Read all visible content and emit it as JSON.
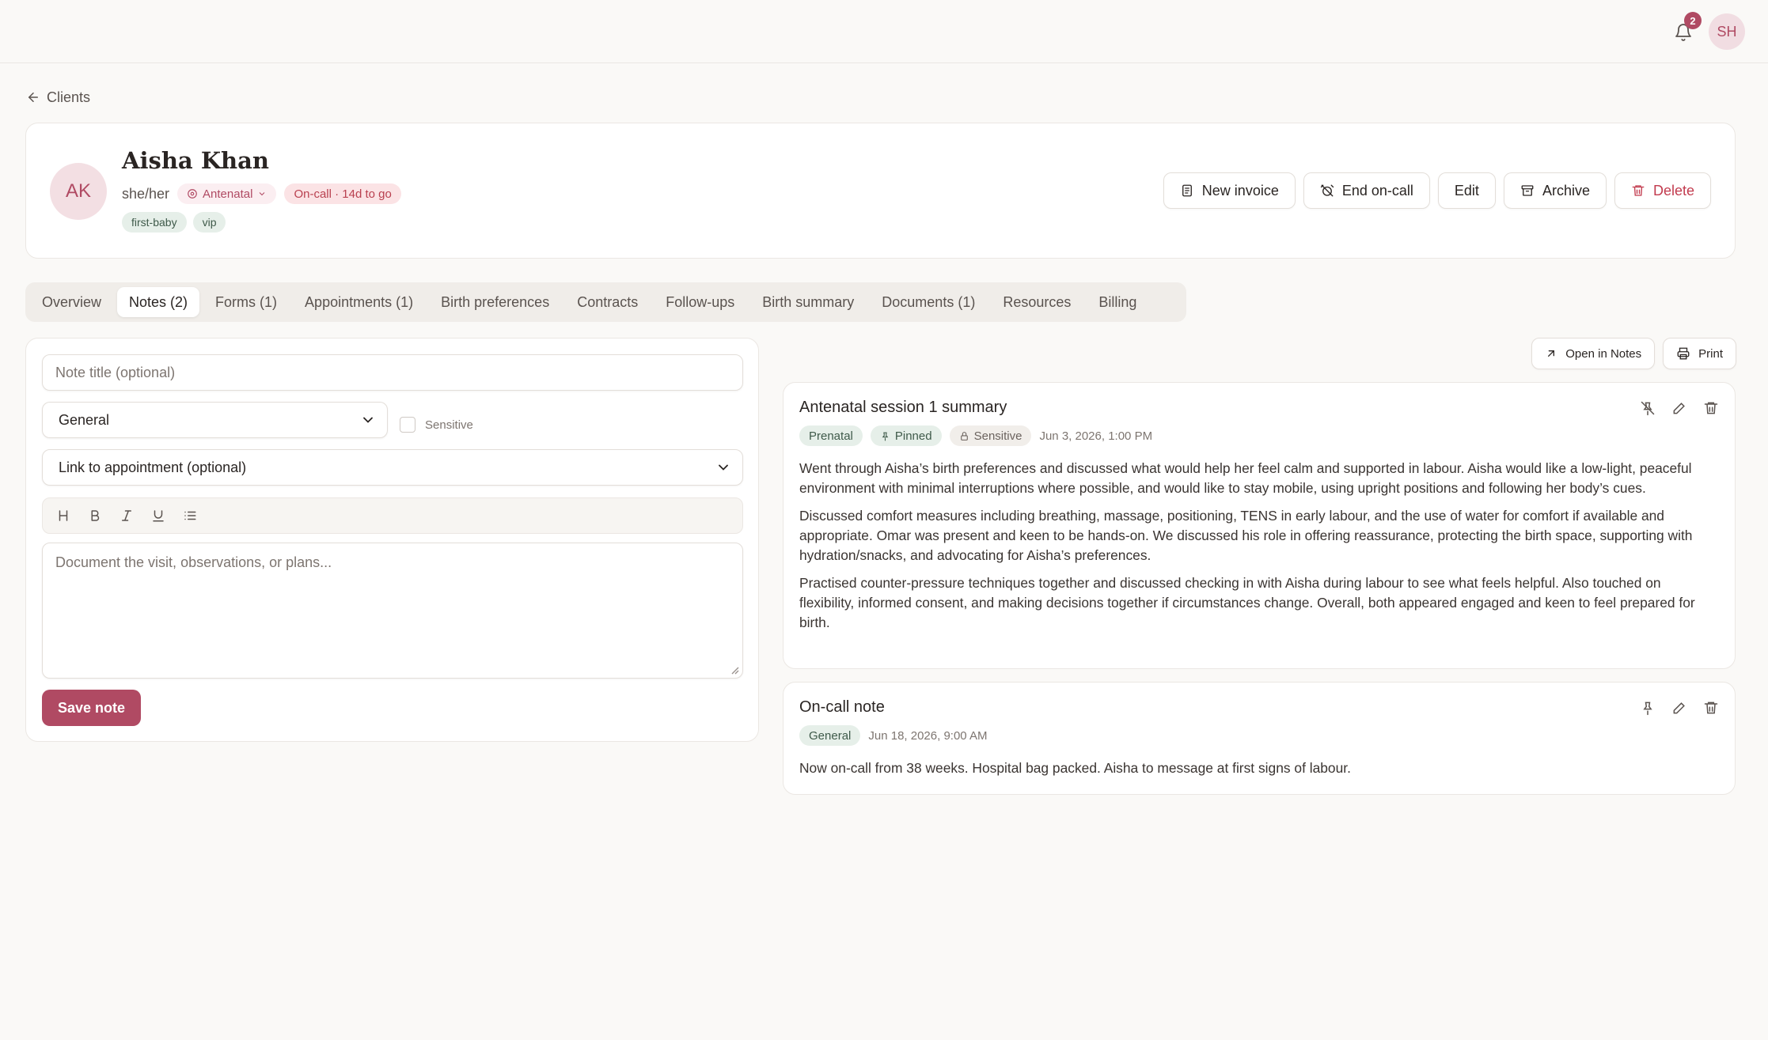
{
  "topbar": {
    "notification_count": "2",
    "user_initials": "SH"
  },
  "back": {
    "label": "Clients"
  },
  "client": {
    "initials": "AK",
    "name": "Aisha Khan",
    "pronouns": "she/her",
    "stage": "Antenatal",
    "oncall_status": "On-call · 14d to go",
    "tags": [
      "first-baby",
      "vip"
    ]
  },
  "actions": {
    "new_invoice": "New invoice",
    "end_oncall": "End on-call",
    "edit": "Edit",
    "archive": "Archive",
    "delete": "Delete"
  },
  "tabs": [
    {
      "label": "Overview"
    },
    {
      "label": "Notes (2)",
      "active": true
    },
    {
      "label": "Forms (1)"
    },
    {
      "label": "Appointments (1)"
    },
    {
      "label": "Birth preferences"
    },
    {
      "label": "Contracts"
    },
    {
      "label": "Follow-ups"
    },
    {
      "label": "Birth summary"
    },
    {
      "label": "Documents (1)"
    },
    {
      "label": "Resources"
    },
    {
      "label": "Billing"
    }
  ],
  "form": {
    "title_placeholder": "Note title (optional)",
    "category_value": "General",
    "sensitive_label": "Sensitive",
    "appointment_value": "Link to appointment (optional)",
    "body_placeholder": "Document the visit, observations, or plans...",
    "save_label": "Save note"
  },
  "right_actions": {
    "open_in_notes": "Open in Notes",
    "print": "Print"
  },
  "notes": [
    {
      "title": "Antenatal session 1 summary",
      "category": "Prenatal",
      "pinned_label": "Pinned",
      "sensitive_label": "Sensitive",
      "timestamp": "Jun 3, 2026, 1:00 PM",
      "paragraphs": [
        "Went through Aisha’s birth preferences and discussed what would help her feel calm and supported in labour. Aisha would like a low-light, peaceful environment with minimal interruptions where possible, and would like to stay mobile, using upright positions and following her body’s cues.",
        "Discussed comfort measures including breathing, massage, positioning, TENS in early labour, and the use of water for comfort if available and appropriate. Omar was present and keen to be hands-on. We discussed his role in offering reassurance, protecting the birth space, supporting with hydration/snacks, and advocating for Aisha’s preferences.",
        "Practised counter-pressure techniques together and discussed checking in with Aisha during labour to see what feels helpful. Also touched on flexibility, informed consent, and making decisions together if circumstances change. Overall, both appeared engaged and keen to feel prepared for birth."
      ]
    },
    {
      "title": "On-call note",
      "category": "General",
      "timestamp": "Jun 18, 2026, 9:00 AM",
      "paragraphs": [
        "Now on-call from 38 weeks. Hospital bag packed. Aisha to message at first signs of labour."
      ]
    }
  ],
  "colors": {
    "accent": "#b04a63",
    "danger": "#c23b4e",
    "tag_green_bg": "#e6efe9",
    "background": "#faf9f7"
  }
}
